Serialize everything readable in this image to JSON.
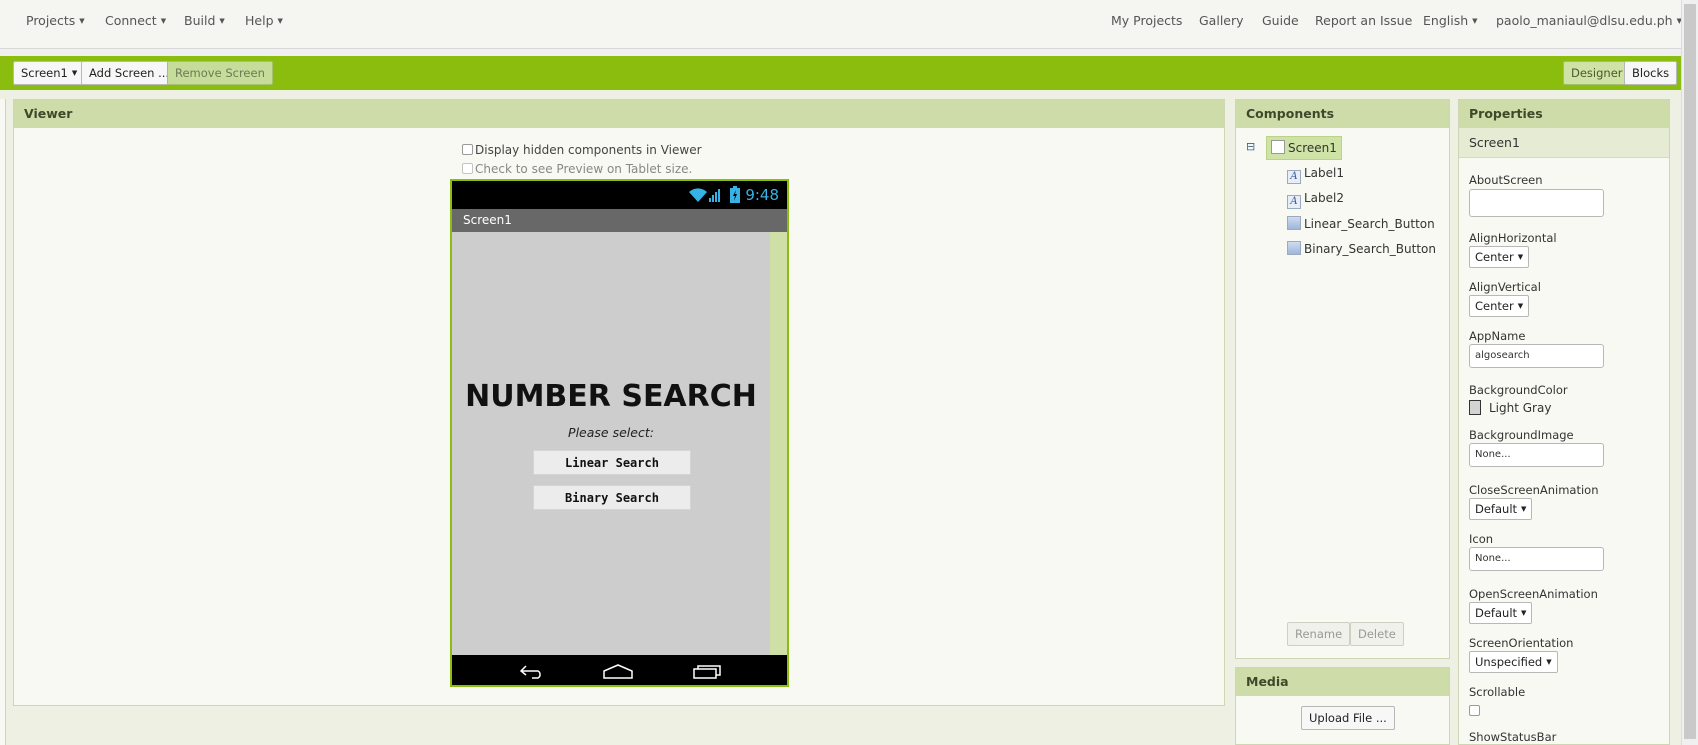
{
  "topnav": {
    "left": [
      "Projects",
      "Connect",
      "Build",
      "Help"
    ],
    "right": [
      "My Projects",
      "Gallery",
      "Guide",
      "Report an Issue",
      "English",
      "paolo_maniaul@dlsu.edu.ph"
    ]
  },
  "toolbar": {
    "screen_select": "Screen1",
    "add_screen": "Add Screen ...",
    "remove_screen": "Remove Screen",
    "designer": "Designer",
    "blocks": "Blocks"
  },
  "viewer": {
    "title": "Viewer",
    "show_hidden": "Display hidden components in Viewer",
    "tablet_preview": "Check to see Preview on Tablet size.",
    "phone": {
      "clock": "9:48",
      "app_title": "Screen1",
      "heading": "NUMBER SEARCH",
      "subheading": "Please select:",
      "buttons": [
        "Linear Search",
        "Binary Search"
      ]
    }
  },
  "components": {
    "title": "Components",
    "root": "Screen1",
    "children": [
      {
        "name": "Label1",
        "icon": "label-icon"
      },
      {
        "name": "Label2",
        "icon": "label-icon"
      },
      {
        "name": "Linear_Search_Button",
        "icon": "button-icon"
      },
      {
        "name": "Binary_Search_Button",
        "icon": "button-icon"
      }
    ],
    "rename": "Rename",
    "delete": "Delete"
  },
  "media": {
    "title": "Media",
    "upload": "Upload File ..."
  },
  "properties": {
    "title": "Properties",
    "screen": "Screen1",
    "about_screen_label": "AboutScreen",
    "align_horizontal_label": "AlignHorizontal",
    "align_horizontal_value": "Center",
    "align_vertical_label": "AlignVertical",
    "align_vertical_value": "Center",
    "app_name_label": "AppName",
    "app_name_value": "algosearch",
    "background_color_label": "BackgroundColor",
    "background_color_value": "Light Gray",
    "background_image_label": "BackgroundImage",
    "background_image_value": "None...",
    "close_anim_label": "CloseScreenAnimation",
    "close_anim_value": "Default",
    "icon_label": "Icon",
    "icon_value": "None...",
    "open_anim_label": "OpenScreenAnimation",
    "open_anim_value": "Default",
    "orientation_label": "ScreenOrientation",
    "orientation_value": "Unspecified",
    "scrollable_label": "Scrollable",
    "show_statusbar_label": "ShowStatusBar"
  },
  "colors": {
    "toolbar_green": "#8bbd0f",
    "panel_header": "#cedcaa",
    "clock_blue": "#35b2e8"
  }
}
